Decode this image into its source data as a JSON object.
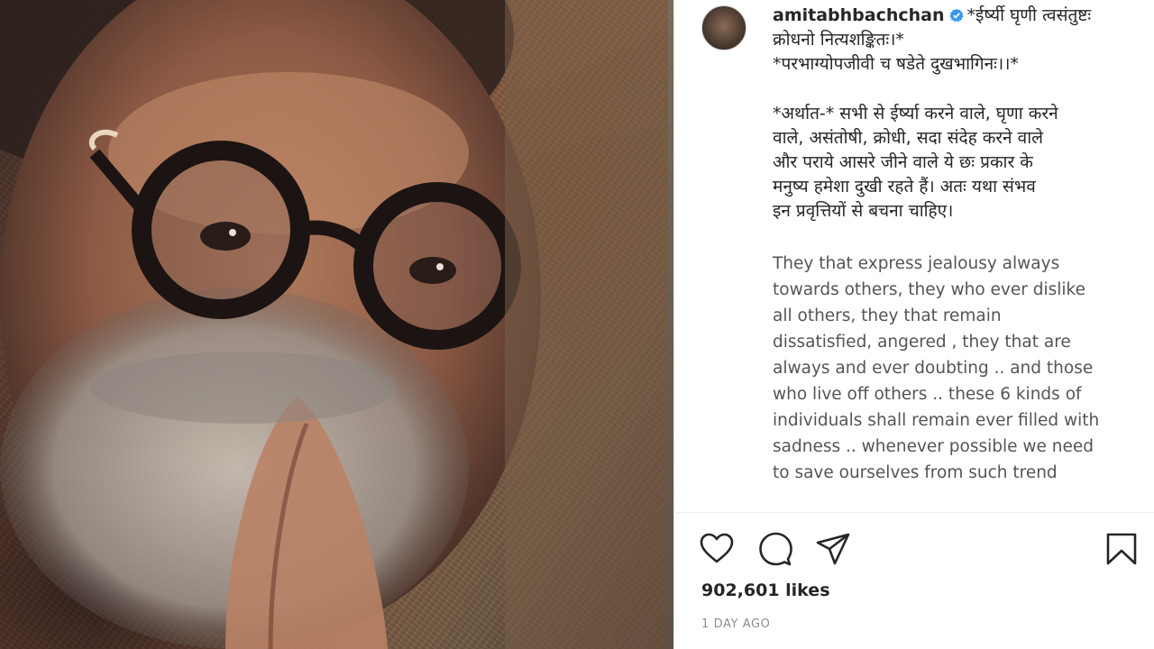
{
  "post": {
    "username": "amitabhbachchan",
    "verified": true,
    "caption_lines": [
      "*ईर्ष्यी घृणी त्वसंतुष्टः",
      "क्रोधनो नित्यशङ्कितः।*",
      "*परभाग्योपजीवी च षडेते दुखभागिनः।।*"
    ],
    "meaning_lines": [
      "*अर्थात-* सभी से ईर्ष्या करने वाले, घृणा करने",
      "वाले, असंतोषी, क्रोधी, सदा संदेह करने वाले",
      "और पराये आसरे जीने वाले ये छः प्रकार के",
      "मनुष्य हमेशा दुखी रहते हैं। अतः यथा संभव",
      "इन प्रवृत्तियों से बचना चाहिए।"
    ],
    "english_lines": [
      "They that express jealousy always",
      "towards others, they who ever dislike",
      "all others, they that remain",
      "dissatisfied, angered , they that are",
      "always and ever doubting .. and those",
      "who live off others .. these 6 kinds of",
      "individuals shall remain ever filled with",
      "sadness .. whenever possible we need",
      "to save ourselves from such trend"
    ],
    "likes": "902,601 likes",
    "timestamp": "1 DAY AGO"
  },
  "icons": {
    "like": "heart-icon",
    "comment": "comment-icon",
    "share": "send-icon",
    "save": "bookmark-icon",
    "verified": "verified-badge-icon"
  },
  "colors": {
    "text": "#262626",
    "secondary": "#8e8e8e",
    "verified": "#3897f0"
  }
}
